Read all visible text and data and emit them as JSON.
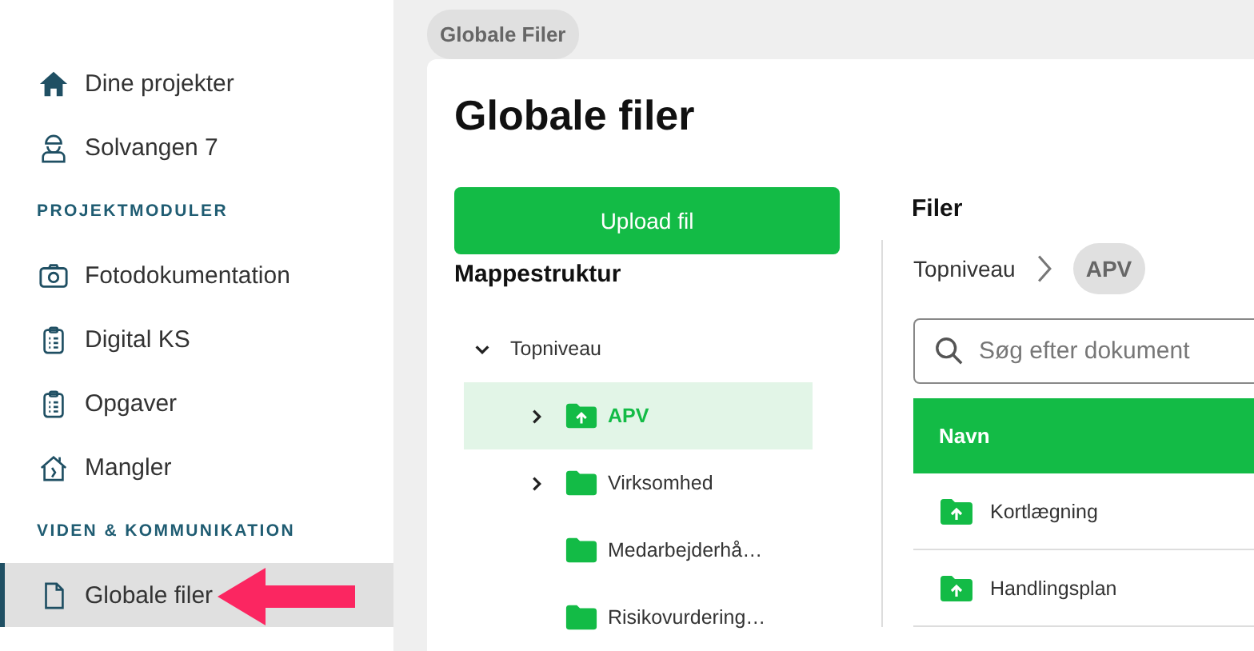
{
  "breadcrumb": {
    "label": "Globale Filer"
  },
  "sidebar": {
    "sections": [
      {
        "items": [
          {
            "label": "Dine projekter",
            "kind": "projects",
            "selected": false
          },
          {
            "label": "Solvangen 7",
            "kind": "project",
            "selected": false
          }
        ]
      },
      {
        "heading": "PROJEKTMODULER",
        "items": [
          {
            "label": "Fotodokumentation",
            "kind": "photos",
            "selected": false
          },
          {
            "label": "Digital KS",
            "kind": "checklist",
            "selected": false
          },
          {
            "label": "Opgaver",
            "kind": "checklist",
            "selected": false
          },
          {
            "label": "Mangler",
            "kind": "defects",
            "selected": false
          }
        ]
      },
      {
        "heading": "VIDEN & KOMMUNIKATION",
        "items": [
          {
            "label": "Globale filer",
            "kind": "file",
            "selected": true
          }
        ]
      }
    ]
  },
  "page": {
    "title": "Globale filer",
    "upload_button": "Upload fil",
    "folders": {
      "heading": "Mappestruktur",
      "tree": [
        {
          "label": "Topniveau",
          "expanded": true,
          "has_children": true,
          "selected": false,
          "children": [
            {
              "label": "APV",
              "kind": "upload-folder",
              "has_children": true,
              "expanded": false,
              "selected": true
            },
            {
              "label": "Virksomhed",
              "kind": "folder",
              "has_children": true,
              "expanded": false,
              "selected": false
            },
            {
              "label": "Medarbejderhå…",
              "kind": "folder",
              "has_children": false,
              "selected": false
            },
            {
              "label": "Risikovurdering…",
              "kind": "folder",
              "has_children": false,
              "selected": false
            }
          ]
        }
      ]
    },
    "files": {
      "heading": "Filer",
      "path": [
        {
          "label": "Topniveau",
          "selected": false
        },
        {
          "label": "APV",
          "selected": true
        }
      ],
      "search": {
        "placeholder": "Søg efter dokument"
      },
      "columns": [
        "Navn"
      ],
      "rows": [
        {
          "name": "Kortlægning",
          "kind": "upload-folder"
        },
        {
          "name": "Handlingsplan",
          "kind": "upload-folder"
        }
      ]
    }
  }
}
